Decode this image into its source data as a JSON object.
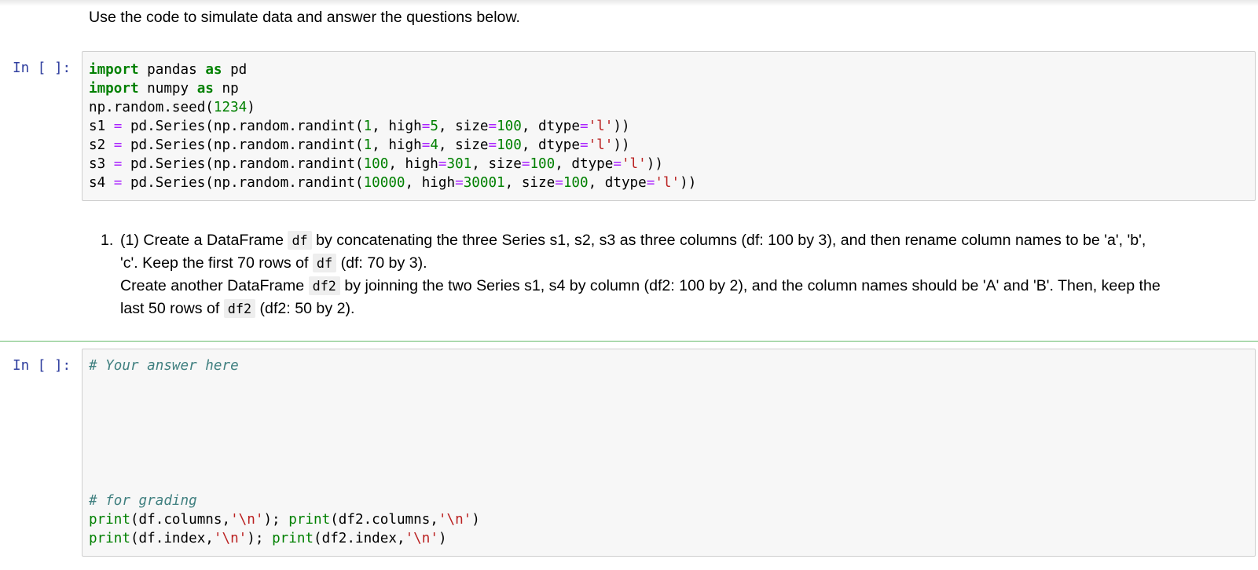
{
  "intro": {
    "text": "Use the code to simulate data and answer the questions below."
  },
  "cell1": {
    "prompt": "In [ ]:",
    "lines": {
      "l1": {
        "kw1": "import",
        "t1": " pandas ",
        "kw2": "as",
        "t2": " pd"
      },
      "l2": {
        "kw1": "import",
        "t1": " numpy ",
        "kw2": "as",
        "t2": " np"
      },
      "l3": {
        "t1": "np.random.seed(",
        "n1": "1234",
        "t2": ")"
      },
      "l4": {
        "t1": "s1 ",
        "op1": "=",
        "t2": " pd.Series(np.random.randint(",
        "n1": "1",
        "t3": ", high",
        "op2": "=",
        "n2": "5",
        "t4": ", size",
        "op3": "=",
        "n3": "100",
        "t5": ", dtype",
        "op4": "=",
        "s1": "'l'",
        "t6": "))"
      },
      "l5": {
        "t1": "s2 ",
        "op1": "=",
        "t2": " pd.Series(np.random.randint(",
        "n1": "1",
        "t3": ", high",
        "op2": "=",
        "n2": "4",
        "t4": ", size",
        "op3": "=",
        "n3": "100",
        "t5": ", dtype",
        "op4": "=",
        "s1": "'l'",
        "t6": "))"
      },
      "l6": {
        "t1": "s3 ",
        "op1": "=",
        "t2": " pd.Series(np.random.randint(",
        "n1": "100",
        "t3": ", high",
        "op2": "=",
        "n2": "301",
        "t4": ", size",
        "op3": "=",
        "n3": "100",
        "t5": ", dtype",
        "op4": "=",
        "s1": "'l'",
        "t6": "))"
      },
      "l7": {
        "t1": "s4 ",
        "op1": "=",
        "t2": " pd.Series(np.random.randint(",
        "n1": "10000",
        "t3": ", high",
        "op2": "=",
        "n2": "30001",
        "t4": ", size",
        "op3": "=",
        "n3": "100",
        "t5": ", dtype",
        "op4": "=",
        "s1": "'l'",
        "t6": "))"
      }
    }
  },
  "question": {
    "number": "1.",
    "line1": {
      "a": "(1) Create a DataFrame ",
      "code": "df",
      "b": " by concatenating the three Series s1, s2, s3 as three columns (df: 100 by 3), and then rename column names to be 'a', 'b',"
    },
    "line2": {
      "a": "'c'. Keep the first 70 rows of ",
      "code": "df",
      "b": " (df: 70 by 3)."
    },
    "line3": {
      "a": "Create another DataFrame ",
      "code": "df2",
      "b": " by joinning the two Series s1, s4 by column (df2: 100 by 2), and the column names should be 'A' and 'B'. Then, keep the"
    },
    "line4": {
      "a": "last 50 rows of ",
      "code": "df2",
      "b": " (df2: 50 by 2)."
    }
  },
  "cell2": {
    "prompt": "In [ ]:",
    "comment1": "# Your answer here",
    "comment2": "# for grading",
    "line3": {
      "bi1": "print",
      "t1": "(df.columns,",
      "s1": "'\\n'",
      "t2": "); ",
      "bi2": "print",
      "t3": "(df2.columns,",
      "s2": "'\\n'",
      "t4": ")"
    },
    "line4": {
      "bi1": "print",
      "t1": "(df.index,",
      "s1": "'\\n'",
      "t2": "); ",
      "bi2": "print",
      "t3": "(df2.index,",
      "s2": "'\\n'",
      "t4": ")"
    }
  }
}
